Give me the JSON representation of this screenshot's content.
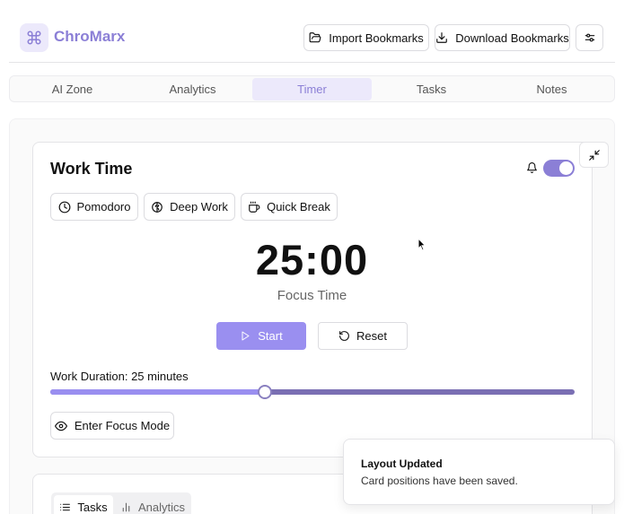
{
  "app": {
    "name": "ChroMarx",
    "brand_color": "#8b7fd6",
    "logo_icon": "command-icon"
  },
  "header": {
    "import_label": "Import Bookmarks",
    "download_label": "Download Bookmarks",
    "settings_icon": "sliders-icon"
  },
  "nav_tabs": [
    {
      "label": "AI Zone",
      "active": false
    },
    {
      "label": "Analytics",
      "active": false
    },
    {
      "label": "Timer",
      "active": true
    },
    {
      "label": "Tasks",
      "active": false
    },
    {
      "label": "Notes",
      "active": false
    }
  ],
  "timer_card": {
    "title": "Work Time",
    "notifications_enabled": true,
    "modes": [
      {
        "label": "Pomodoro",
        "icon": "clock-icon"
      },
      {
        "label": "Deep Work",
        "icon": "brain-icon"
      },
      {
        "label": "Quick Break",
        "icon": "coffee-icon"
      }
    ],
    "time_display": "25:00",
    "phase_label": "Focus Time",
    "start_label": "Start",
    "reset_label": "Reset",
    "duration_label": "Work Duration: 25 minutes",
    "duration_fraction": 0.41,
    "focus_mode_label": "Enter Focus Mode"
  },
  "bottom_card": {
    "tabs": [
      {
        "label": "Tasks",
        "active": true
      },
      {
        "label": "Analytics",
        "active": false
      }
    ]
  },
  "toast": {
    "title": "Layout Updated",
    "message": "Card positions have been saved."
  }
}
